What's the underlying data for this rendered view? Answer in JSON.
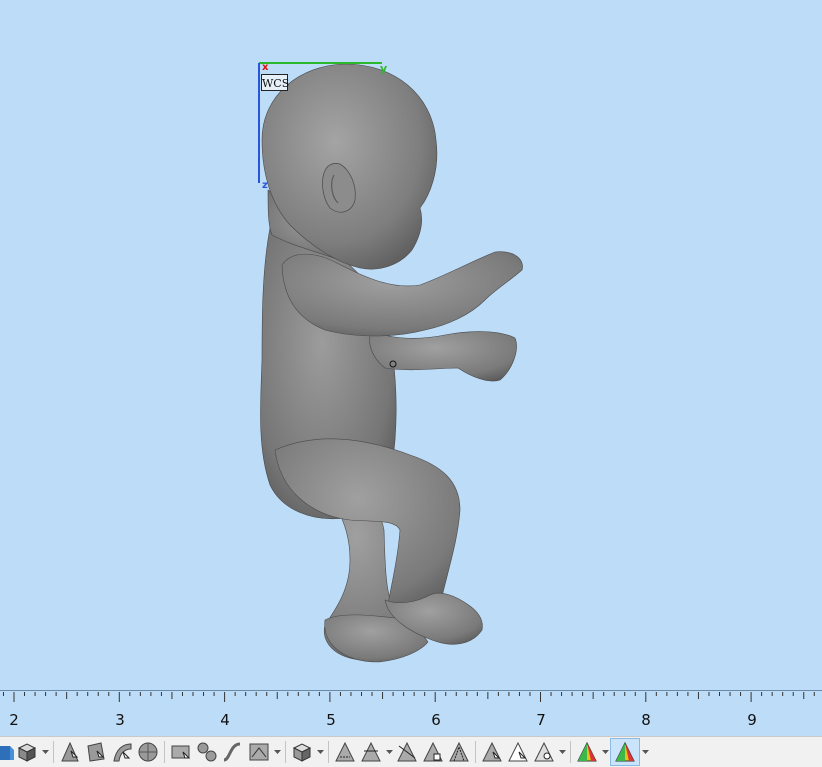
{
  "viewport": {
    "coordinate_system_label": "WCS",
    "axis_labels": {
      "x": "x",
      "y": "y",
      "z": "z"
    },
    "background_color": "#bddcf7",
    "model_color": "#8a8a8a"
  },
  "ruler": {
    "labels": [
      "2",
      "3",
      "4",
      "5",
      "6",
      "7",
      "8",
      "9"
    ]
  },
  "toolbar": {
    "icons": [
      "view-cube-icon",
      "solid-box-icon",
      "pick-face-icon",
      "pick-surface-icon",
      "pick-curve-icon",
      "pick-sphere-icon",
      "select-rect-icon",
      "pick-fan-icon",
      "pick-spline-icon",
      "pick-image-icon",
      "pick-body-icon",
      "measure-point-icon",
      "measure-edge-icon",
      "measure-angle-icon",
      "measure-face-icon",
      "measure-area-icon",
      "snap-vertex-icon",
      "snap-line-icon",
      "snap-circle-icon",
      "shaded-color-icon",
      "shaded-color-active-icon"
    ]
  }
}
